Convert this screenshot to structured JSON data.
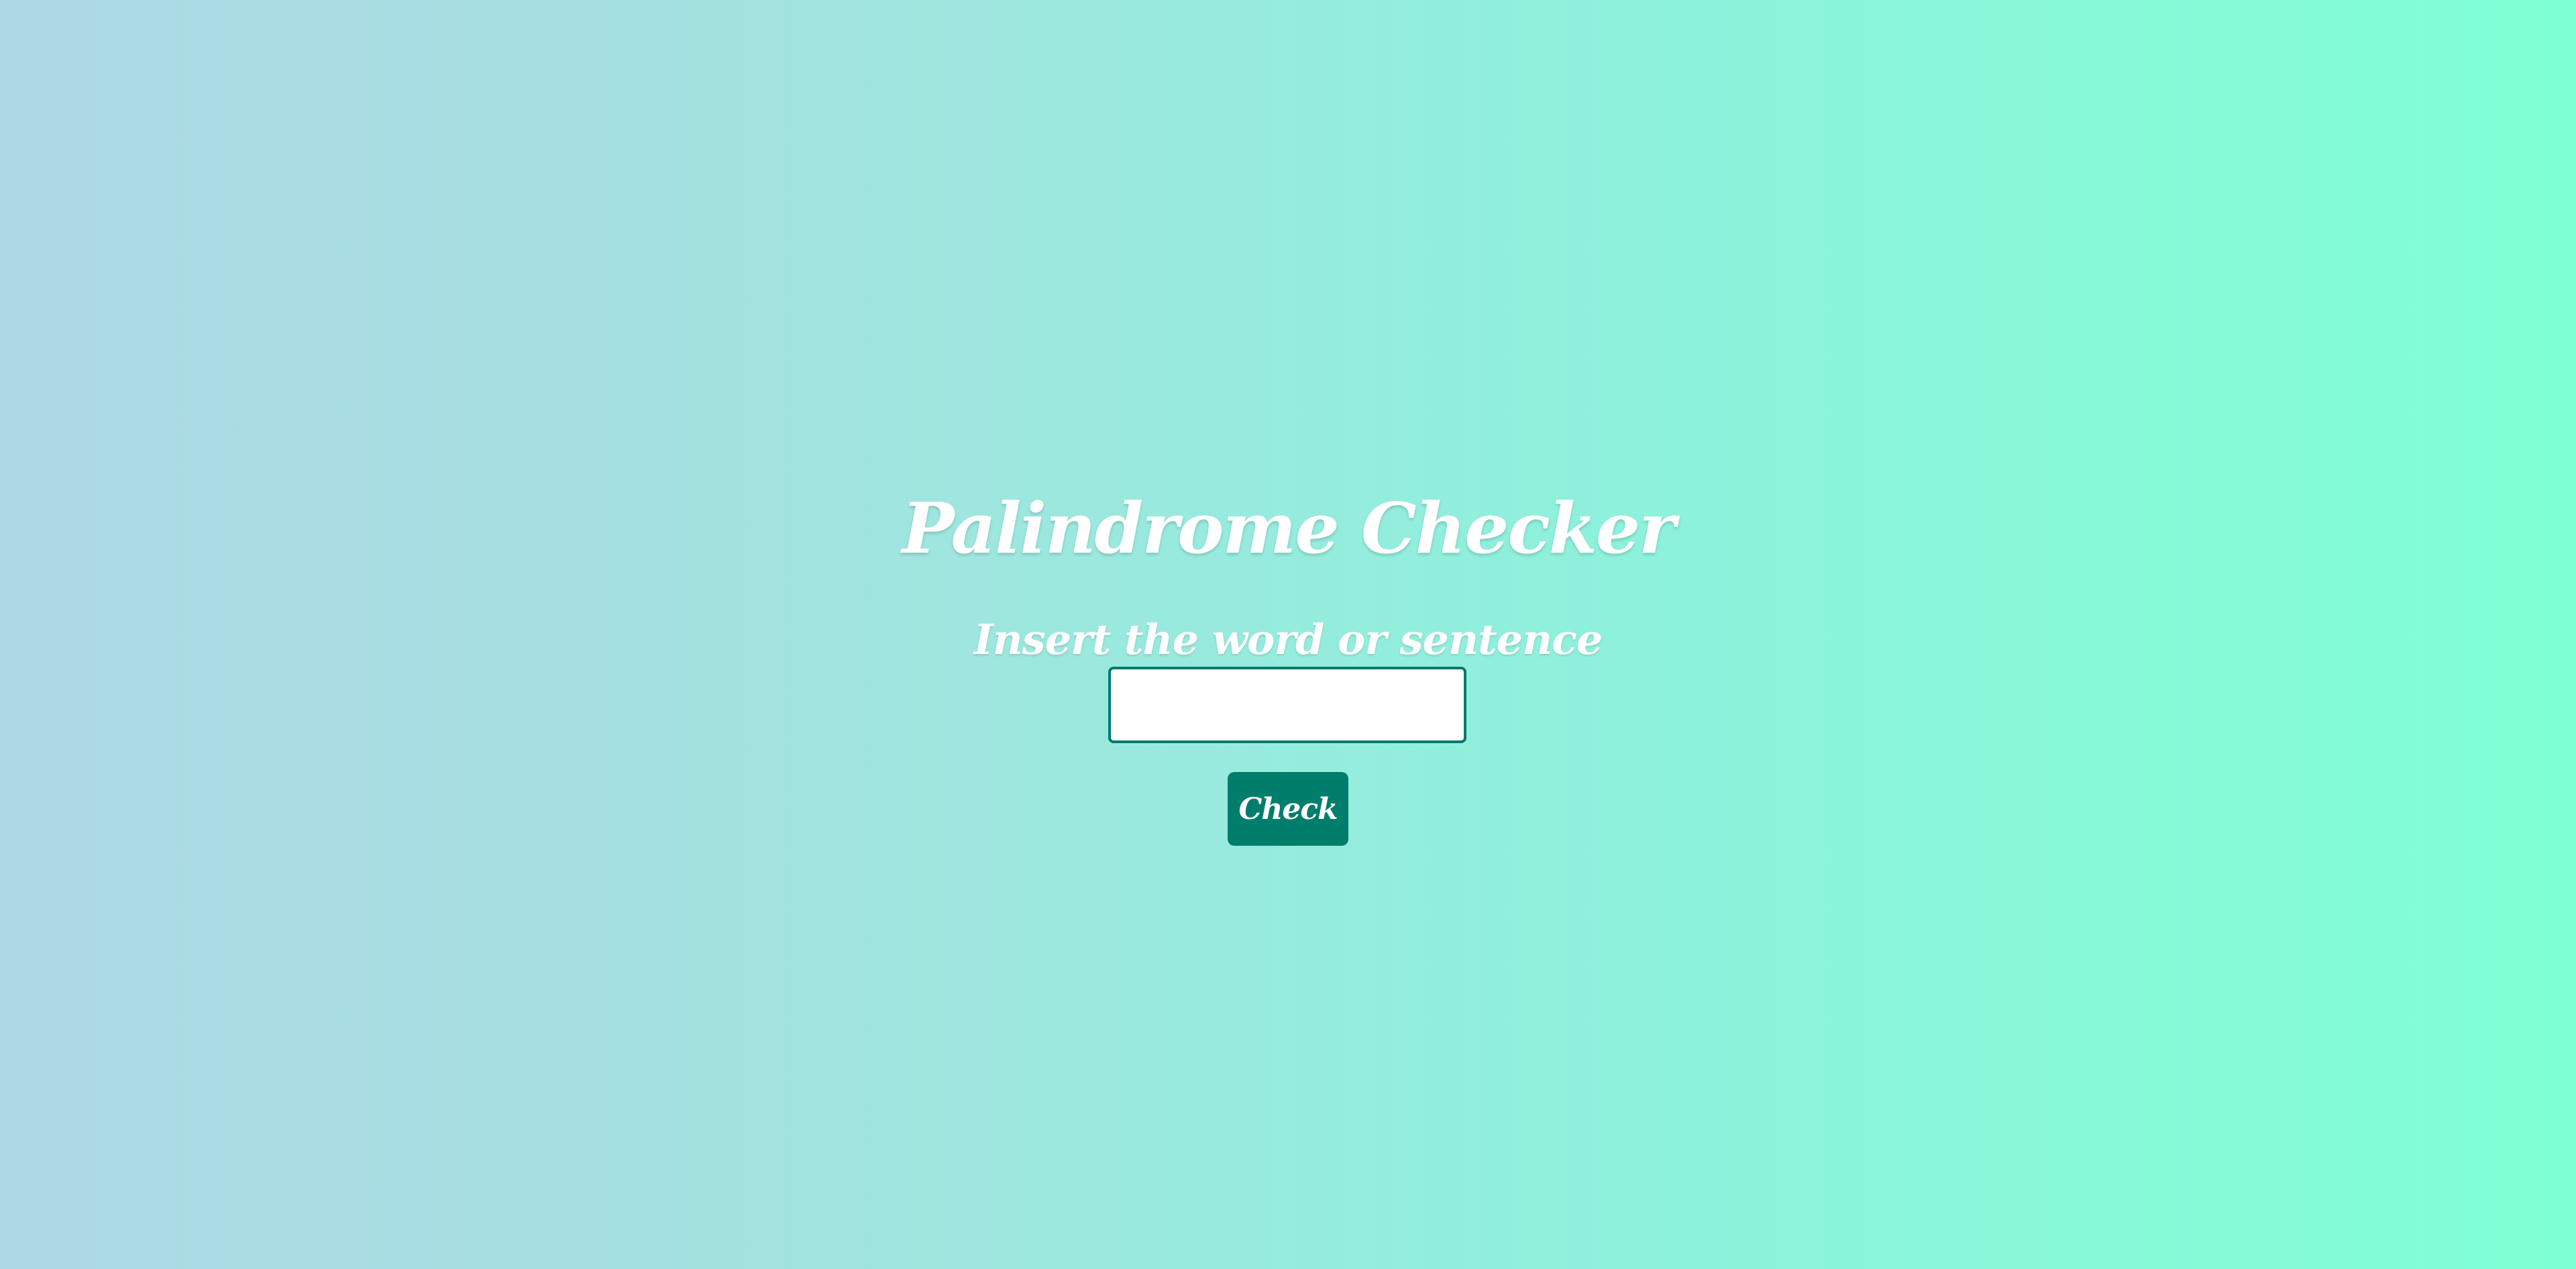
{
  "page": {
    "title": "Palindrome Checker",
    "subtitle": "Insert the word or sentence"
  },
  "form": {
    "input_value": "",
    "input_placeholder": "",
    "check_label": "Check"
  },
  "colors": {
    "gradient_start": "#aed8e6",
    "gradient_end": "#7fffd4",
    "button_bg": "#007e6b",
    "input_border": "#00796b",
    "text": "#ffffff"
  }
}
